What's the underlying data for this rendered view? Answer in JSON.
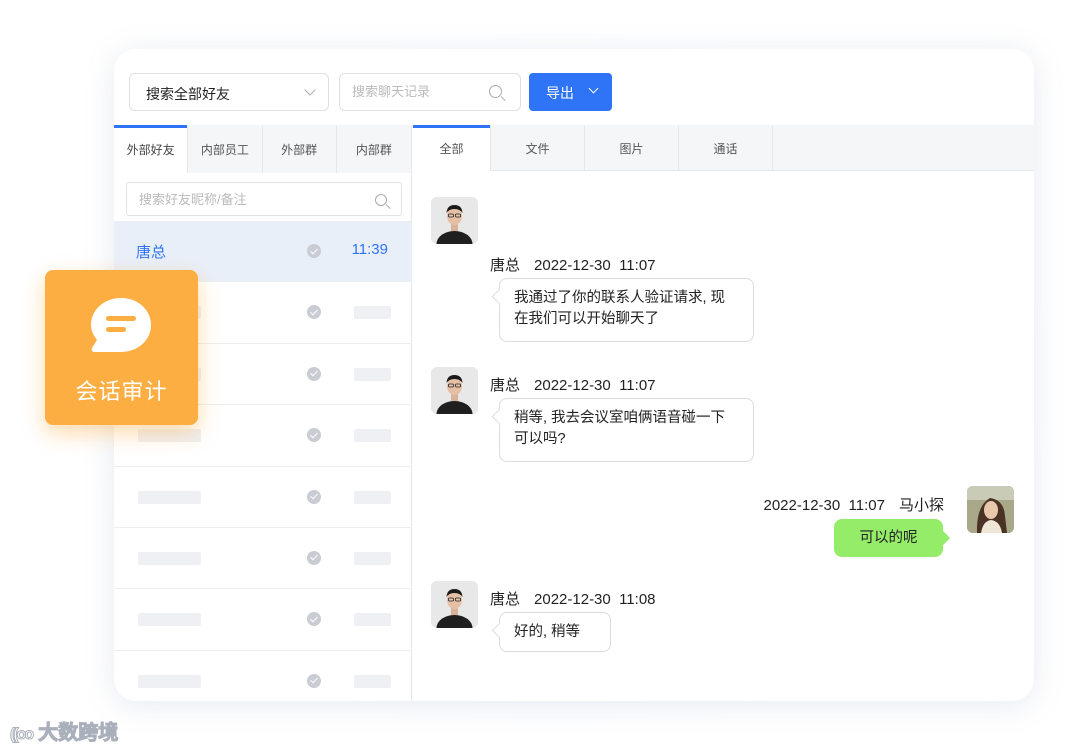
{
  "toolbar": {
    "friend_filter_value": "搜索全部好友",
    "chat_search_placeholder": "搜索聊天记录",
    "export_label": "导出"
  },
  "left_tabs": [
    "外部好友",
    "内部员工",
    "外部群",
    "内部群"
  ],
  "friend_search_placeholder": "搜索好友昵称/备注",
  "friends": [
    {
      "name": "唐总",
      "time": "11:39"
    }
  ],
  "right_tabs": [
    "全部",
    "文件",
    "图片",
    "通话"
  ],
  "messages": [
    {
      "sender": "唐总",
      "time": "2022-12-30  11:07",
      "text": "我通过了你的联系人验证请求, 现在我们可以开始聊天了"
    },
    {
      "sender": "唐总",
      "time": "2022-12-30  11:07",
      "text": "稍等, 我去会议室咱俩语音碰一下可以吗?"
    },
    {
      "sender": "马小探",
      "time": "2022-12-30  11:07",
      "text": "可以的呢"
    },
    {
      "sender": "唐总",
      "time": "2022-12-30  11:08",
      "text": "好的, 稍等"
    }
  ],
  "badge": {
    "label": "会话审计"
  },
  "watermark": {
    "mark": "((oo",
    "text": "大数跨境"
  },
  "colors": {
    "accent": "#2f74f6",
    "badge": "#fcae43",
    "bubble_self": "#95ec69"
  }
}
